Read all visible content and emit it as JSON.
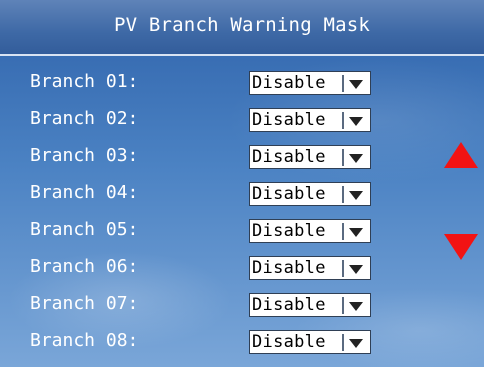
{
  "header": {
    "title": "PV Branch Warning Mask"
  },
  "branches": [
    {
      "label": "Branch 01:",
      "value": "Disable"
    },
    {
      "label": "Branch 02:",
      "value": "Disable"
    },
    {
      "label": "Branch 03:",
      "value": "Disable"
    },
    {
      "label": "Branch 04:",
      "value": "Disable"
    },
    {
      "label": "Branch 05:",
      "value": "Disable"
    },
    {
      "label": "Branch 06:",
      "value": "Disable"
    },
    {
      "label": "Branch 07:",
      "value": "Disable"
    },
    {
      "label": "Branch 08:",
      "value": "Disable"
    }
  ],
  "scroll": {
    "up_icon": "triangle-up-icon",
    "down_icon": "triangle-down-icon"
  },
  "colors": {
    "title_bar": "#3e69a6",
    "background": "#4b82c3",
    "scroll_arrow": "#f21313"
  }
}
